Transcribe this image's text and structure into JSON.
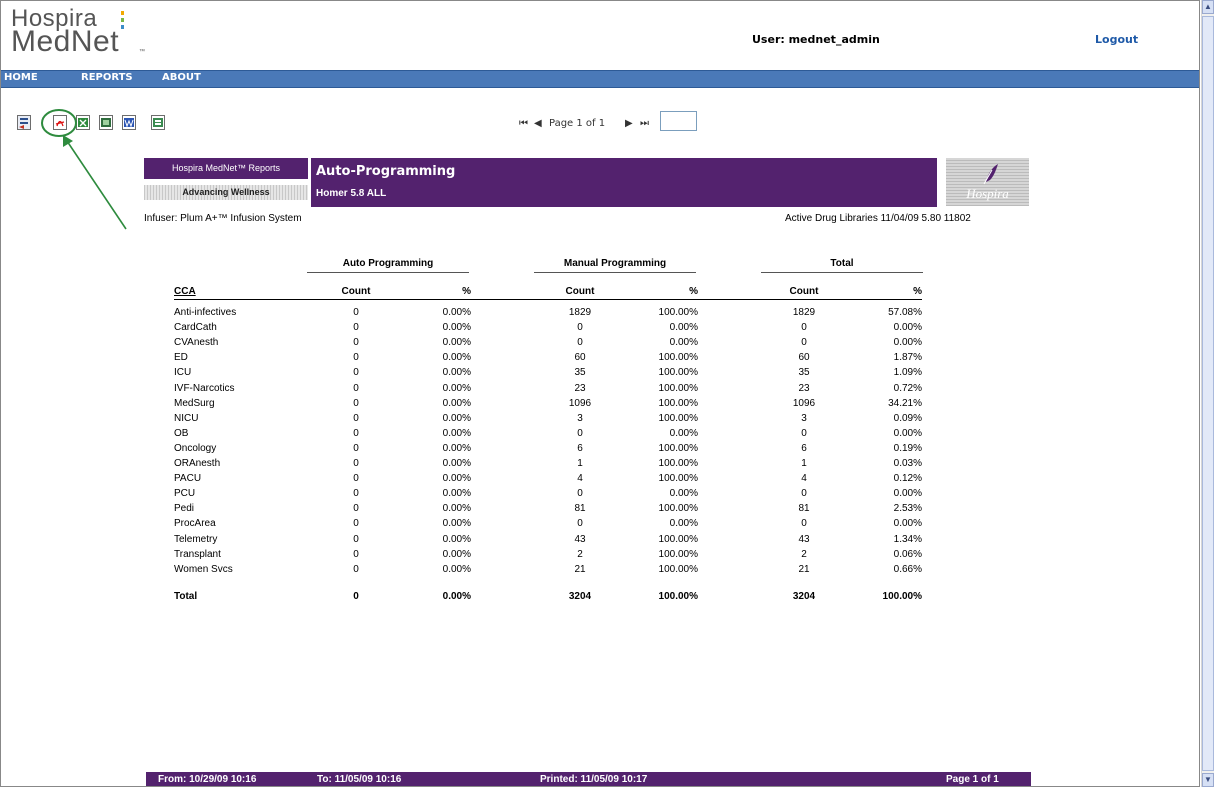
{
  "header": {
    "logo_line1": "Hospira",
    "logo_line2": "MedNet",
    "logo_tm": "™",
    "user_label": "User: mednet_admin",
    "logout_label": "Logout"
  },
  "nav": {
    "items": [
      "HOME",
      "REPORTS",
      "ABOUT"
    ]
  },
  "toolbar": {
    "icons": [
      "export-icon",
      "pdf-icon",
      "excel-icon",
      "excel-data-icon",
      "word-icon",
      "rtf-icon"
    ],
    "first_page": "⏮",
    "prev_page": "◀",
    "page_text": "Page 1 of 1",
    "next_page": "▶",
    "last_page": "⏭",
    "page_input_value": ""
  },
  "report": {
    "brand_label": "Hospira MedNet™ Reports",
    "tagline": "Advancing Wellness",
    "title": "Auto-Programming",
    "subtitle": "Homer 5.8 ALL",
    "logo_text": "Hospira",
    "infuser": "Infuser: Plum A+™ Infusion System",
    "libraries": "Active Drug Libraries 11/04/09 5.80 11802",
    "group_headers": [
      "Auto Programming",
      "Manual Programming",
      "Total"
    ],
    "column_headers": [
      "CCA",
      "Count",
      "%",
      "Count",
      "%",
      "Count",
      "%"
    ],
    "rows": [
      [
        "Anti-infectives",
        "0",
        "0.00%",
        "1829",
        "100.00%",
        "1829",
        "57.08%"
      ],
      [
        "CardCath",
        "0",
        "0.00%",
        "0",
        "0.00%",
        "0",
        "0.00%"
      ],
      [
        "CVAnesth",
        "0",
        "0.00%",
        "0",
        "0.00%",
        "0",
        "0.00%"
      ],
      [
        "ED",
        "0",
        "0.00%",
        "60",
        "100.00%",
        "60",
        "1.87%"
      ],
      [
        "ICU",
        "0",
        "0.00%",
        "35",
        "100.00%",
        "35",
        "1.09%"
      ],
      [
        "IVF-Narcotics",
        "0",
        "0.00%",
        "23",
        "100.00%",
        "23",
        "0.72%"
      ],
      [
        "MedSurg",
        "0",
        "0.00%",
        "1096",
        "100.00%",
        "1096",
        "34.21%"
      ],
      [
        "NICU",
        "0",
        "0.00%",
        "3",
        "100.00%",
        "3",
        "0.09%"
      ],
      [
        "OB",
        "0",
        "0.00%",
        "0",
        "0.00%",
        "0",
        "0.00%"
      ],
      [
        "Oncology",
        "0",
        "0.00%",
        "6",
        "100.00%",
        "6",
        "0.19%"
      ],
      [
        "ORAnesth",
        "0",
        "0.00%",
        "1",
        "100.00%",
        "1",
        "0.03%"
      ],
      [
        "PACU",
        "0",
        "0.00%",
        "4",
        "100.00%",
        "4",
        "0.12%"
      ],
      [
        "PCU",
        "0",
        "0.00%",
        "0",
        "0.00%",
        "0",
        "0.00%"
      ],
      [
        "Pedi",
        "0",
        "0.00%",
        "81",
        "100.00%",
        "81",
        "2.53%"
      ],
      [
        "ProcArea",
        "0",
        "0.00%",
        "0",
        "0.00%",
        "0",
        "0.00%"
      ],
      [
        "Telemetry",
        "0",
        "0.00%",
        "43",
        "100.00%",
        "43",
        "1.34%"
      ],
      [
        "Transplant",
        "0",
        "0.00%",
        "2",
        "100.00%",
        "2",
        "0.06%"
      ],
      [
        "Women Svcs",
        "0",
        "0.00%",
        "21",
        "100.00%",
        "21",
        "0.66%"
      ]
    ],
    "total_row": [
      "Total",
      "0",
      "0.00%",
      "3204",
      "100.00%",
      "3204",
      "100.00%"
    ]
  },
  "footer": {
    "from": "From: 10/29/09 10:16",
    "to": "To: 11/05/09 10:16",
    "printed": "Printed: 11/05/09 10:17",
    "page": "Page 1 of 1"
  },
  "colors": {
    "nav_blue": "#4a79b8",
    "report_purple": "#53226e",
    "link_blue": "#1f5aa8",
    "annotation_green": "#2e8b3e"
  }
}
